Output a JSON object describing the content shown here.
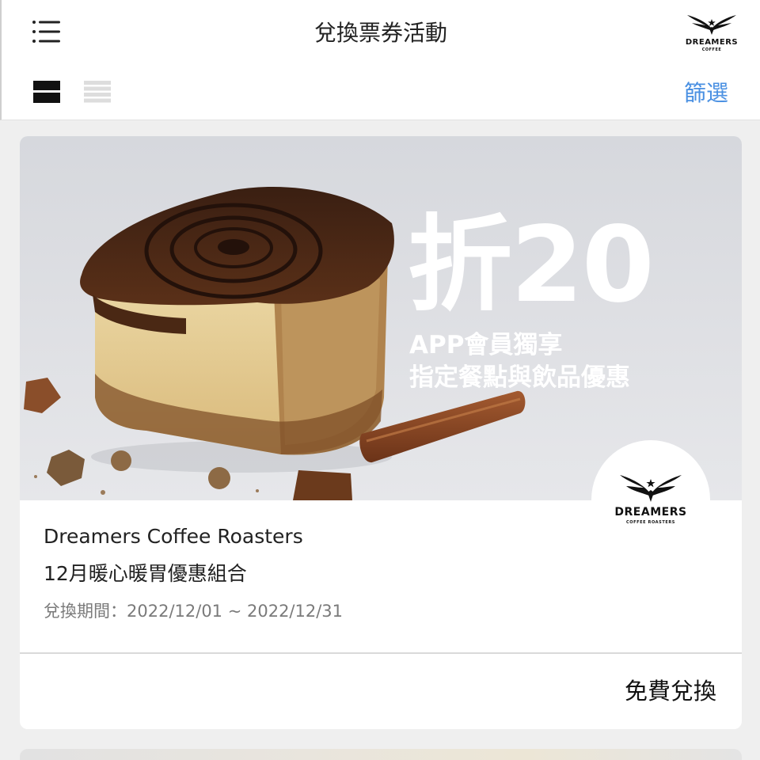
{
  "header": {
    "title": "兌換票券活動",
    "menu_icon": "menu-icon",
    "brand_logo": {
      "icon": "dreamers-coffee-logo",
      "text": "DREAMERS",
      "subtext": "COFFEE"
    },
    "view_toggle": {
      "card_view_icon": "card-view-icon",
      "list_view_icon": "list-view-icon",
      "active": "card"
    },
    "filter_label": "篩選",
    "accent_color": "#4a90e2"
  },
  "coupons": [
    {
      "banner": {
        "discount_text": "折20",
        "promo_line1": "APP會員獨享",
        "promo_line2": "指定餐點與飲品優惠",
        "image": "cinnamon-roll-photo"
      },
      "merchant_logo": {
        "icon": "dreamers-coffee-roasters-logo",
        "text": "DREAMERS",
        "subtext": "COFFEE ROASTERS"
      },
      "merchant": "Dreamers Coffee Roasters",
      "name": "12月暖心暖胃優惠組合",
      "period": "兌換期間：2022/12/01 ~ 2022/12/31",
      "action_label": "免費兌換"
    }
  ]
}
